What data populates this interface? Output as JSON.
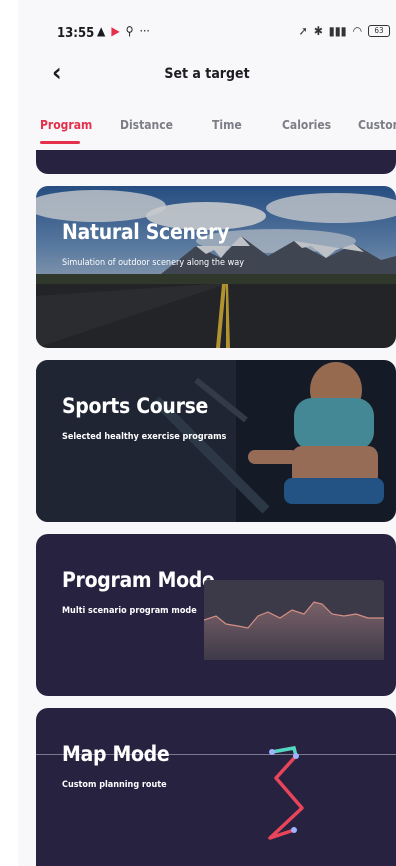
{
  "status": {
    "time": "13:55",
    "left_icons": [
      "warning-icon",
      "play-icon",
      "location-pin-icon"
    ],
    "more": "···",
    "battery": "63"
  },
  "header": {
    "back_glyph": "‹",
    "title": "Set a target"
  },
  "tabs": [
    {
      "label": "Program",
      "active": true
    },
    {
      "label": "Distance",
      "active": false
    },
    {
      "label": "Time",
      "active": false
    },
    {
      "label": "Calories",
      "active": false
    },
    {
      "label": "Customi",
      "active": false
    }
  ],
  "cards": [
    {
      "title": "Natural Scenery",
      "subtitle": "Simulation of outdoor scenery along the way"
    },
    {
      "title": "Sports Course",
      "subtitle": "Selected healthy exercise programs"
    },
    {
      "title": "Program Mode",
      "subtitle": "Multi scenario program mode"
    },
    {
      "title": "Map Mode",
      "subtitle": "Custom planning route"
    }
  ],
  "colors": {
    "accent": "#e5304c",
    "card_dark": "#272240",
    "route": "#e8455a",
    "route_start": "#4fd8c4"
  }
}
